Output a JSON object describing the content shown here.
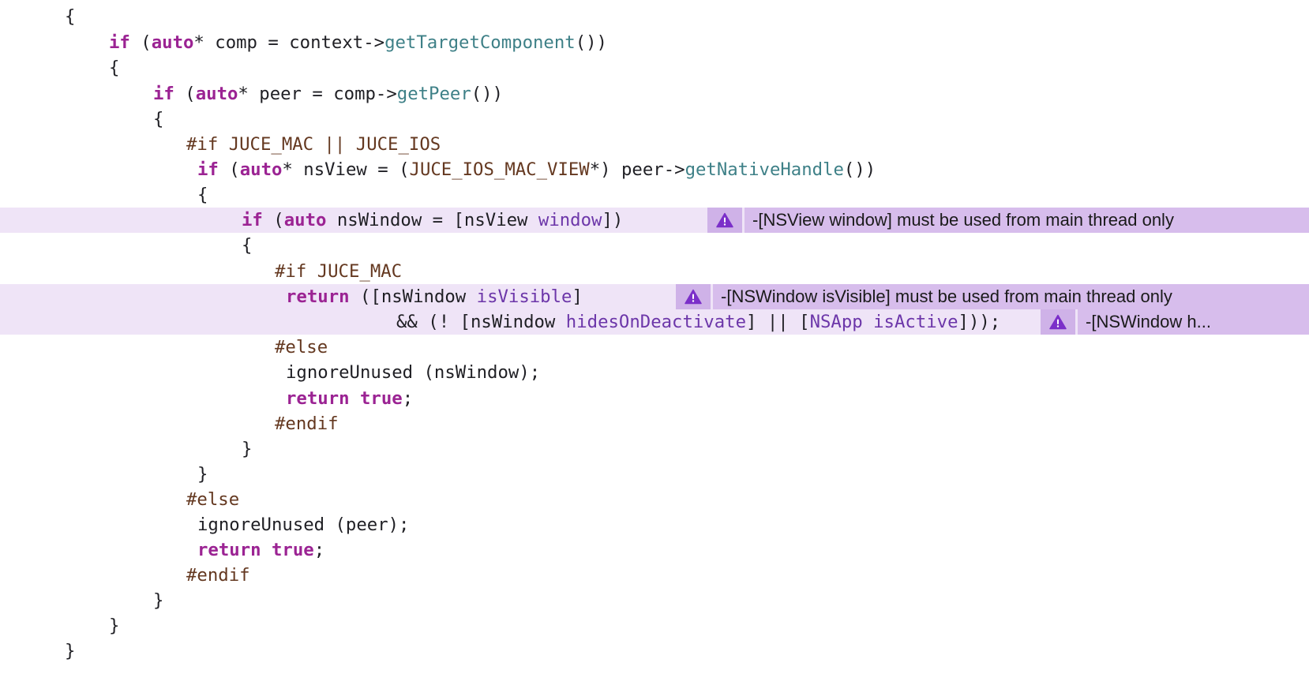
{
  "colors": {
    "keyword": "#9b2393",
    "function": "#3e8087",
    "preprocessor": "#643820",
    "objc_class": "#6c36a9",
    "plain": "#1f1f24",
    "highlight_line": "#efe4f7",
    "issue_bubble": "#d7bdec",
    "issue_icon_bg": "#cfb2e8",
    "warning_icon": "#7b2fc9"
  },
  "editor": {
    "lines": [
      {
        "tokens": [
          [
            "pl",
            "{"
          ]
        ]
      },
      {
        "tokens": [
          [
            "kw",
            "if"
          ],
          [
            "pl",
            " ("
          ],
          [
            "kw",
            "auto"
          ],
          [
            "pl",
            "* comp = context->"
          ],
          [
            "fn",
            "getTargetComponent"
          ],
          [
            "pl",
            "())"
          ]
        ]
      },
      {
        "tokens": [
          [
            "pl",
            "{"
          ]
        ]
      },
      {
        "tokens": [
          [
            "kw",
            "if"
          ],
          [
            "pl",
            " ("
          ],
          [
            "kw",
            "auto"
          ],
          [
            "pl",
            "* peer = comp->"
          ],
          [
            "fn",
            "getPeer"
          ],
          [
            "pl",
            "())"
          ]
        ]
      },
      {
        "tokens": [
          [
            "pl",
            "{"
          ]
        ]
      },
      {
        "tokens": [
          [
            "pp",
            "#if JUCE_MAC || JUCE_IOS"
          ]
        ]
      },
      {
        "tokens": [
          [
            "kw",
            "if"
          ],
          [
            "pl",
            " ("
          ],
          [
            "kw",
            "auto"
          ],
          [
            "pl",
            "* nsView = ("
          ],
          [
            "pp",
            "JUCE_IOS_MAC_VIEW"
          ],
          [
            "pl",
            "*) peer->"
          ],
          [
            "fn",
            "getNativeHandle"
          ],
          [
            "pl",
            "())"
          ]
        ]
      },
      {
        "tokens": [
          [
            "pl",
            "{"
          ]
        ]
      },
      {
        "tokens": [
          [
            "kw",
            "if"
          ],
          [
            "pl",
            " ("
          ],
          [
            "kw",
            "auto"
          ],
          [
            "pl",
            " nsWindow = [nsView "
          ],
          [
            "cls",
            "window"
          ],
          [
            "pl",
            "])"
          ]
        ]
      },
      {
        "tokens": [
          [
            "pl",
            "{"
          ]
        ]
      },
      {
        "tokens": [
          [
            "pp",
            "#if JUCE_MAC"
          ]
        ]
      },
      {
        "tokens": [
          [
            "kw",
            "return"
          ],
          [
            "pl",
            " ([nsWindow "
          ],
          [
            "cls",
            "isVisible"
          ],
          [
            "pl",
            "]"
          ]
        ]
      },
      {
        "tokens": [
          [
            "pl",
            "&& (! [nsWindow "
          ],
          [
            "cls",
            "hidesOnDeactivate"
          ],
          [
            "pl",
            "] || ["
          ],
          [
            "cls",
            "NSApp"
          ],
          [
            "pl",
            " "
          ],
          [
            "cls",
            "isActive"
          ],
          [
            "pl",
            "]));"
          ]
        ]
      },
      {
        "tokens": [
          [
            "pp",
            "#else"
          ]
        ]
      },
      {
        "tokens": [
          [
            "pl",
            "ignoreUnused (nsWindow);"
          ]
        ]
      },
      {
        "tokens": [
          [
            "kw",
            "return"
          ],
          [
            "pl",
            " "
          ],
          [
            "kw",
            "true"
          ],
          [
            "pl",
            ";"
          ]
        ]
      },
      {
        "tokens": [
          [
            "pp",
            "#endif"
          ]
        ]
      },
      {
        "tokens": [
          [
            "pl",
            "}"
          ]
        ]
      },
      {
        "tokens": [
          [
            "pl",
            "}"
          ]
        ]
      },
      {
        "tokens": [
          [
            "pp",
            "#else"
          ]
        ]
      },
      {
        "tokens": [
          [
            "pl",
            "ignoreUnused (peer);"
          ]
        ]
      },
      {
        "tokens": [
          [
            "kw",
            "return"
          ],
          [
            "pl",
            " "
          ],
          [
            "kw",
            "true"
          ],
          [
            "pl",
            ";"
          ]
        ]
      },
      {
        "tokens": [
          [
            "pp",
            "#endif"
          ]
        ]
      },
      {
        "tokens": [
          [
            "pl",
            "}"
          ]
        ]
      },
      {
        "tokens": [
          [
            "pl",
            "}"
          ]
        ]
      },
      {
        "tokens": [
          [
            "pl",
            "}"
          ]
        ]
      }
    ],
    "issues": [
      {
        "line": 8,
        "icon": "warning-triangle-icon",
        "message": "-[NSView window] must be used from main thread only"
      },
      {
        "line": 11,
        "icon": "warning-triangle-icon",
        "message": "-[NSWindow isVisible] must be used from main thread only"
      },
      {
        "line": 12,
        "icon": "warning-triangle-icon",
        "message": "-[NSWindow h..."
      }
    ]
  }
}
